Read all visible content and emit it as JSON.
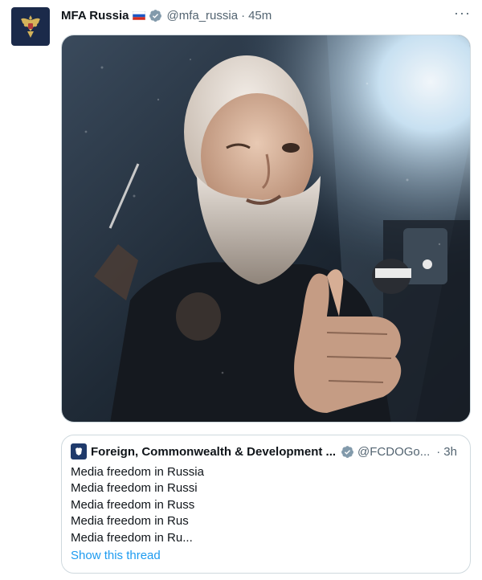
{
  "tweet": {
    "display_name": "MFA Russia",
    "handle": "@mfa_russia",
    "separator": "·",
    "time": "45m",
    "more": "···",
    "flag_icon": "russia-flag-icon",
    "verified_icon": "verified-badge-icon",
    "verified_color": "#829aab"
  },
  "quote": {
    "display_name": "Foreign, Commonwealth & Development ...",
    "handle": "@FCDOGo...",
    "separator": "·",
    "time": "3h",
    "lines": [
      "Media freedom in Russia",
      "Media freedom in Russi",
      "Media freedom in Russ",
      "Media freedom in Rus",
      "Media freedom in Ru..."
    ],
    "show_thread": "Show this thread",
    "link_color": "#1d9bf0"
  }
}
